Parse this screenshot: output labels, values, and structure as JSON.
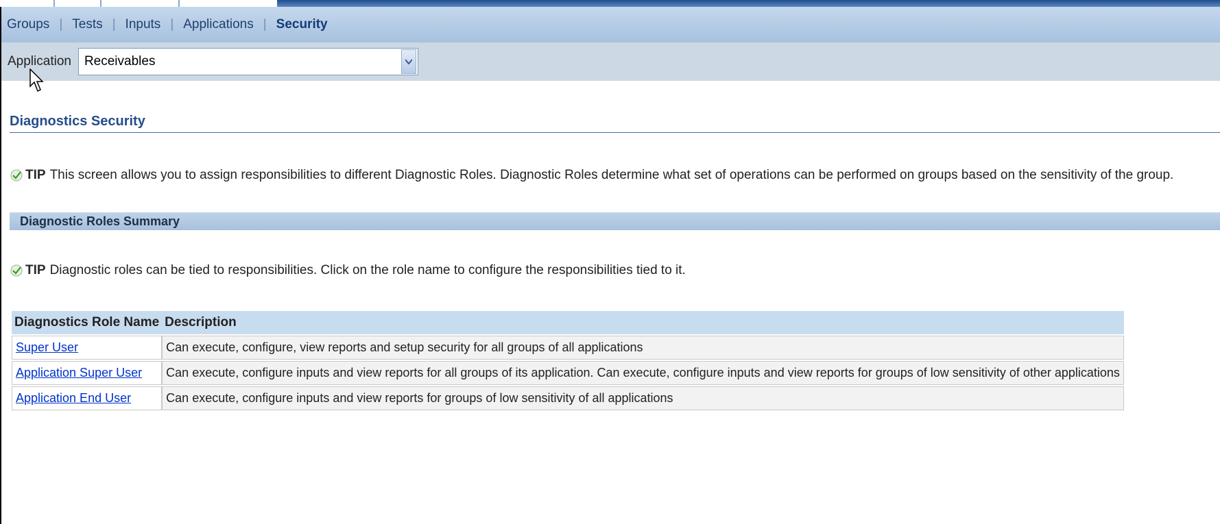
{
  "nav": {
    "tabs": [
      {
        "label": "Groups",
        "active": false
      },
      {
        "label": "Tests",
        "active": false
      },
      {
        "label": "Inputs",
        "active": false
      },
      {
        "label": "Applications",
        "active": false
      },
      {
        "label": "Security",
        "active": true
      }
    ],
    "separator": "|"
  },
  "application_filter": {
    "label": "Application",
    "selected": "Receivables",
    "arrow_icon": "chevron-down-icon"
  },
  "page": {
    "section_title": "Diagnostics Security",
    "tip1": {
      "icon": "checkmark-icon",
      "word": "TIP",
      "text": "This screen allows you to assign responsibilities to different Diagnostic Roles. Diagnostic Roles determine what set of operations can be performed on groups based on the sensitivity of the group."
    },
    "subheader": "Diagnostic Roles Summary",
    "tip2": {
      "icon": "checkmark-icon",
      "word": "TIP",
      "text": "Diagnostic roles can be tied to responsibilities. Click on the role name to configure the responsibilities tied to it."
    }
  },
  "roles_table": {
    "columns": [
      "Diagnostics Role Name",
      "Description"
    ],
    "rows": [
      {
        "name": "Super User",
        "description": "Can execute, configure, view reports and setup security for all groups of all applications"
      },
      {
        "name": "Application Super User",
        "description": "Can execute, configure inputs and view reports for all groups of its application. Can execute, configure inputs and view reports for groups of low sensitivity of other applications"
      },
      {
        "name": "Application End User",
        "description": "Can execute, configure inputs and view reports for groups of low sensitivity of all applications"
      }
    ]
  },
  "colors": {
    "nav_bg": "#b4cbe6",
    "appbar_bg": "#ccd8e3",
    "title_blue": "#254d8a",
    "link_blue": "#0033cc",
    "tip_check": "#3a9a2a"
  }
}
